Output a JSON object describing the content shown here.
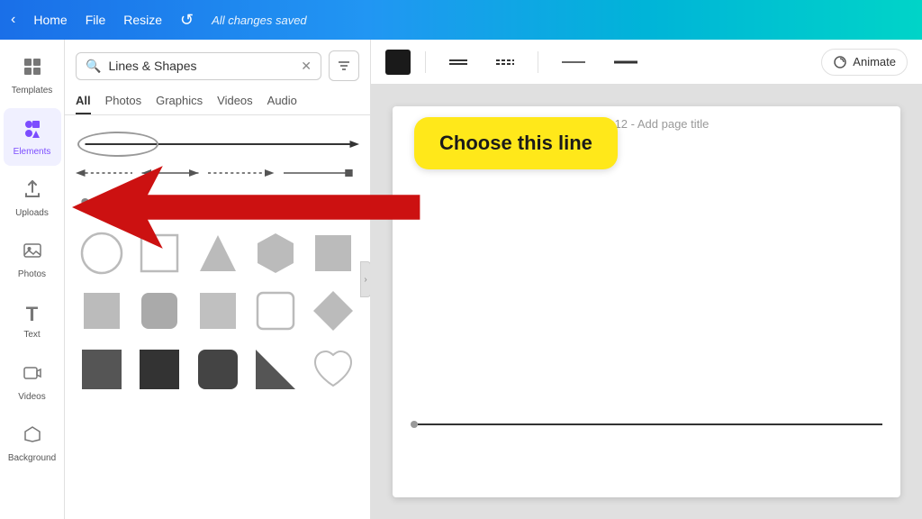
{
  "topbar": {
    "home_label": "Home",
    "file_label": "File",
    "resize_label": "Resize",
    "saved_label": "All changes saved"
  },
  "sidebar": {
    "items": [
      {
        "id": "templates",
        "label": "Templates",
        "icon": "⊞"
      },
      {
        "id": "elements",
        "label": "Elements",
        "icon": "✦",
        "active": true
      },
      {
        "id": "uploads",
        "label": "Uploads",
        "icon": "↑"
      },
      {
        "id": "photos",
        "label": "Photos",
        "icon": "🖼"
      },
      {
        "id": "text",
        "label": "Text",
        "icon": "T"
      },
      {
        "id": "videos",
        "label": "Videos",
        "icon": "▶"
      },
      {
        "id": "background",
        "label": "Background",
        "icon": "⬡"
      }
    ]
  },
  "panel": {
    "search_placeholder": "Lines & Shapes",
    "search_value": "Lines & Shapes",
    "tabs": [
      {
        "id": "all",
        "label": "All",
        "active": true
      },
      {
        "id": "photos",
        "label": "Photos",
        "active": false
      },
      {
        "id": "graphics",
        "label": "Graphics",
        "active": false
      },
      {
        "id": "videos",
        "label": "Videos",
        "active": false
      },
      {
        "id": "audio",
        "label": "Audio",
        "active": false
      }
    ]
  },
  "toolbar": {
    "animate_label": "Animate"
  },
  "canvas": {
    "page_label": "Page 12 - Add page title"
  },
  "annotation": {
    "tooltip_text": "Choose this line"
  }
}
